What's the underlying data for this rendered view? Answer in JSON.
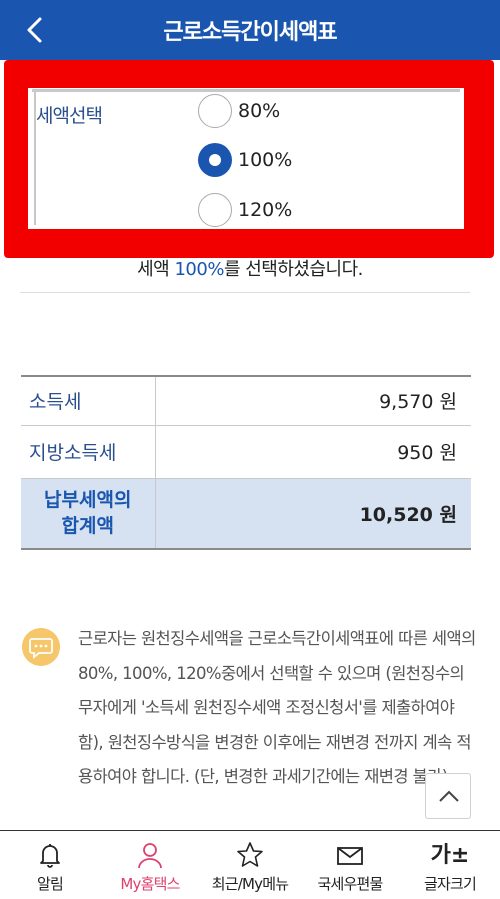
{
  "header": {
    "title": "근로소득간이세액표"
  },
  "selection": {
    "label": "세액선택",
    "options": [
      {
        "label": "80%",
        "selected": false
      },
      {
        "label": "100%",
        "selected": true
      },
      {
        "label": "120%",
        "selected": false
      }
    ],
    "message_prefix": "세액 ",
    "message_percent": "100%",
    "message_suffix": "를 선택하셨습니다."
  },
  "table": {
    "rows": [
      {
        "label": "소득세",
        "value": "9,570 원"
      },
      {
        "label": "지방소득세",
        "value": "950 원"
      }
    ],
    "total": {
      "label_line1": "납부세액의",
      "label_line2": "합계액",
      "value": "10,520 원"
    }
  },
  "note": {
    "text": "근로자는 원천징수세액을 근로소득간이세액표에 따른 세액의 80%, 100%, 120%중에서 선택할 수 있으며 (원천징수의무자에게 '소득세 원천징수세액 조정신청서'를 제출하여야 함), 원천징수방식을 변경한 이후에는 재변경 전까지 계속 적용하여야 합니다. (단, 변경한 과세기간에는 재변경 불가)"
  },
  "bottom_nav": [
    {
      "label": "알림",
      "icon": "bell-icon"
    },
    {
      "label": "My홈택스",
      "icon": "user-icon",
      "active": true
    },
    {
      "label": "최근/My메뉴",
      "icon": "star-icon"
    },
    {
      "label": "국세우편물",
      "icon": "mail-icon"
    },
    {
      "label": "글자크기",
      "icon": "font-size-icon",
      "glyph": "가±"
    }
  ],
  "colors": {
    "header": "#1a56b0",
    "highlight": "#f20000",
    "accent": "#1a56b0",
    "active_nav": "#e0406c",
    "info_icon": "#f5c66a",
    "total_row": "#d6e2f1"
  }
}
